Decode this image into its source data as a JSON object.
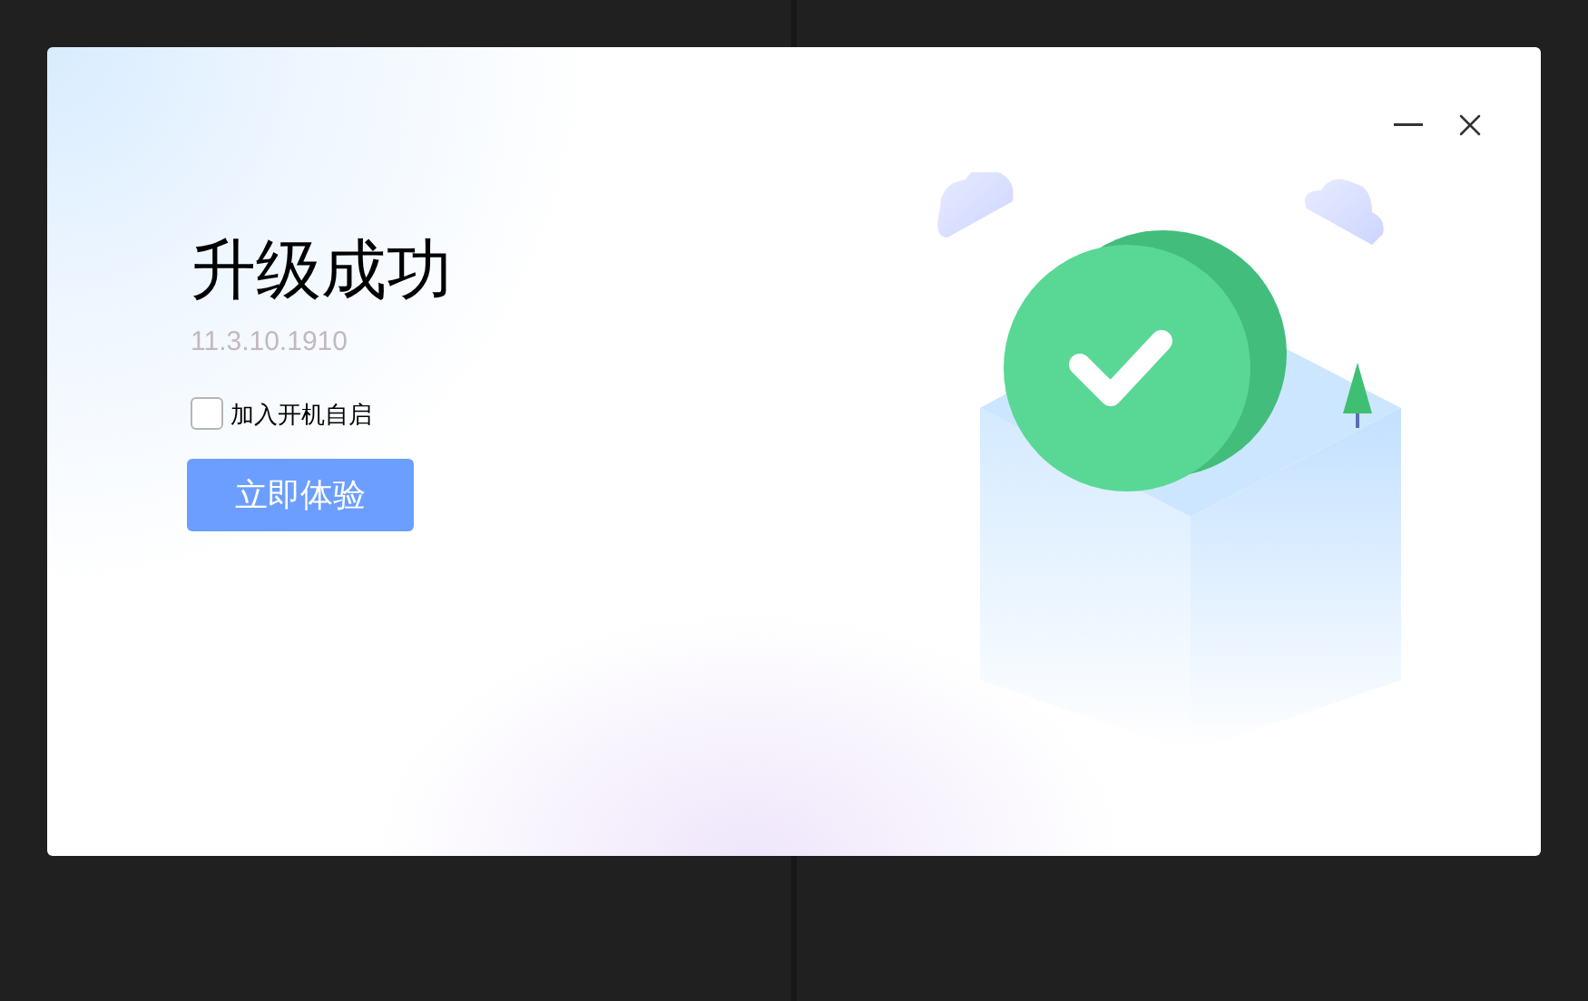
{
  "dialog": {
    "title": "升级成功",
    "version": "11.3.10.1910",
    "autostart": {
      "label": "加入开机自启",
      "checked": false
    },
    "button": "立即体验"
  }
}
